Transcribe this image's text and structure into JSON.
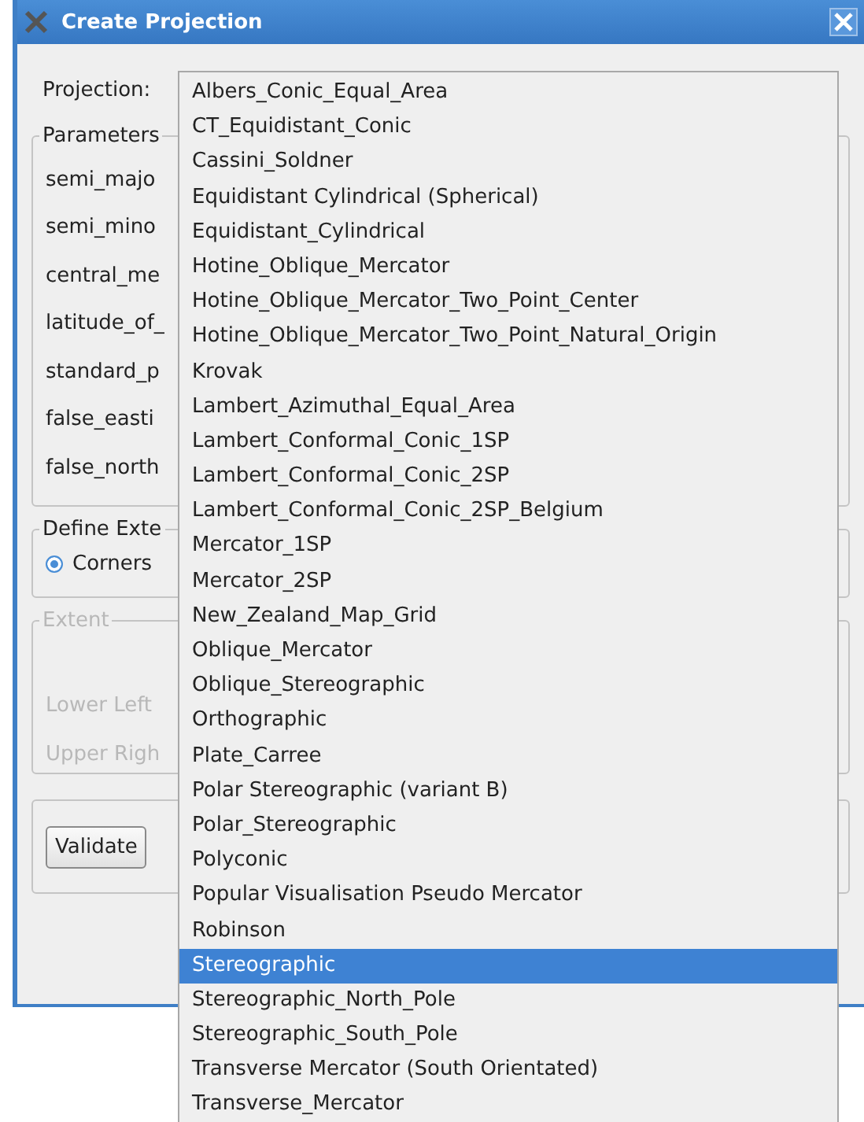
{
  "window": {
    "title": "Create Projection"
  },
  "projection": {
    "label": "Projection:"
  },
  "parameters": {
    "title": "Parameters",
    "rows": [
      "semi_majo",
      "semi_mino",
      "central_me",
      "latitude_of_",
      "standard_p",
      "false_easti",
      "false_north"
    ]
  },
  "define_extent": {
    "title": "Define Exte",
    "option": {
      "label": "Corners",
      "selected": true
    }
  },
  "extent": {
    "title": "Extent",
    "disabled": true,
    "rows": [
      "Lower Left",
      "Upper Righ"
    ]
  },
  "validate_button": "Validate",
  "dropdown": {
    "items": [
      {
        "label": "Albers_Conic_Equal_Area",
        "selected": false
      },
      {
        "label": "CT_Equidistant_Conic",
        "selected": false
      },
      {
        "label": "Cassini_Soldner",
        "selected": false
      },
      {
        "label": "Equidistant Cylindrical (Spherical)",
        "selected": false
      },
      {
        "label": "Equidistant_Cylindrical",
        "selected": false
      },
      {
        "label": "Hotine_Oblique_Mercator",
        "selected": false
      },
      {
        "label": "Hotine_Oblique_Mercator_Two_Point_Center",
        "selected": false
      },
      {
        "label": "Hotine_Oblique_Mercator_Two_Point_Natural_Origin",
        "selected": false
      },
      {
        "label": "Krovak",
        "selected": false
      },
      {
        "label": "Lambert_Azimuthal_Equal_Area",
        "selected": false
      },
      {
        "label": "Lambert_Conformal_Conic_1SP",
        "selected": false
      },
      {
        "label": "Lambert_Conformal_Conic_2SP",
        "selected": false
      },
      {
        "label": "Lambert_Conformal_Conic_2SP_Belgium",
        "selected": false
      },
      {
        "label": "Mercator_1SP",
        "selected": false
      },
      {
        "label": "Mercator_2SP",
        "selected": false
      },
      {
        "label": "New_Zealand_Map_Grid",
        "selected": false
      },
      {
        "label": "Oblique_Mercator",
        "selected": false
      },
      {
        "label": "Oblique_Stereographic",
        "selected": false
      },
      {
        "label": "Orthographic",
        "selected": false
      },
      {
        "label": "Plate_Carree",
        "selected": false
      },
      {
        "label": "Polar Stereographic (variant B)",
        "selected": false
      },
      {
        "label": "Polar_Stereographic",
        "selected": false
      },
      {
        "label": "Polyconic",
        "selected": false
      },
      {
        "label": "Popular Visualisation Pseudo Mercator",
        "selected": false
      },
      {
        "label": "Robinson",
        "selected": false
      },
      {
        "label": "Stereographic",
        "selected": true
      },
      {
        "label": "Stereographic_North_Pole",
        "selected": false
      },
      {
        "label": "Stereographic_South_Pole",
        "selected": false
      },
      {
        "label": "Transverse Mercator (South Orientated)",
        "selected": false
      },
      {
        "label": "Transverse_Mercator",
        "selected": false
      }
    ]
  }
}
